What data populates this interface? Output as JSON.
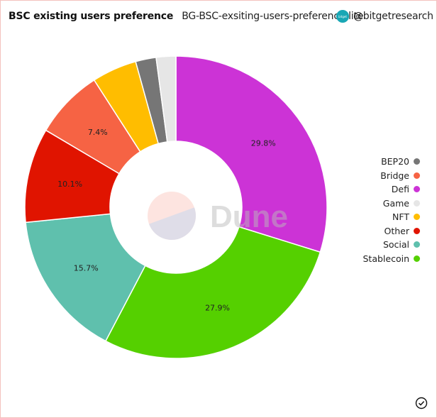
{
  "header": {
    "title": "BSC existing users preference",
    "query_name": "BG-BSC-exsiting-users-preference-lite",
    "author_avatar_text": "bitget",
    "author_handle": "@bitgetresearch"
  },
  "watermark": "Dune",
  "status_icon": "check-circle-icon",
  "chart_data": {
    "type": "pie",
    "variant": "donut",
    "title": "BSC existing users preference",
    "slices": [
      {
        "label": "Defi",
        "value": 29.8,
        "color": "#cc33d6",
        "data_label": "29.8%"
      },
      {
        "label": "Stablecoin",
        "value": 27.9,
        "color": "#55d000",
        "data_label": "27.9%"
      },
      {
        "label": "Social",
        "value": 15.7,
        "color": "#5fc0ad",
        "data_label": "15.7%"
      },
      {
        "label": "Other",
        "value": 10.1,
        "color": "#e01400",
        "data_label": "10.1%"
      },
      {
        "label": "Bridge",
        "value": 7.4,
        "color": "#f66344",
        "data_label": "7.4%"
      },
      {
        "label": "NFT",
        "value": 4.8,
        "color": "#ffbd00",
        "data_label": ""
      },
      {
        "label": "BEP20",
        "value": 2.2,
        "color": "#767676",
        "data_label": ""
      },
      {
        "label": "Game",
        "value": 2.1,
        "color": "#e6e6e6",
        "data_label": ""
      }
    ],
    "legend": {
      "position": "right",
      "entries": [
        {
          "label": "BEP20",
          "color": "#767676"
        },
        {
          "label": "Bridge",
          "color": "#f66344"
        },
        {
          "label": "Defi",
          "color": "#cc33d6"
        },
        {
          "label": "Game",
          "color": "#e6e6e6"
        },
        {
          "label": "NFT",
          "color": "#ffbd00"
        },
        {
          "label": "Other",
          "color": "#e01400"
        },
        {
          "label": "Social",
          "color": "#5fc0ad"
        },
        {
          "label": "Stablecoin",
          "color": "#55d000"
        }
      ]
    }
  }
}
